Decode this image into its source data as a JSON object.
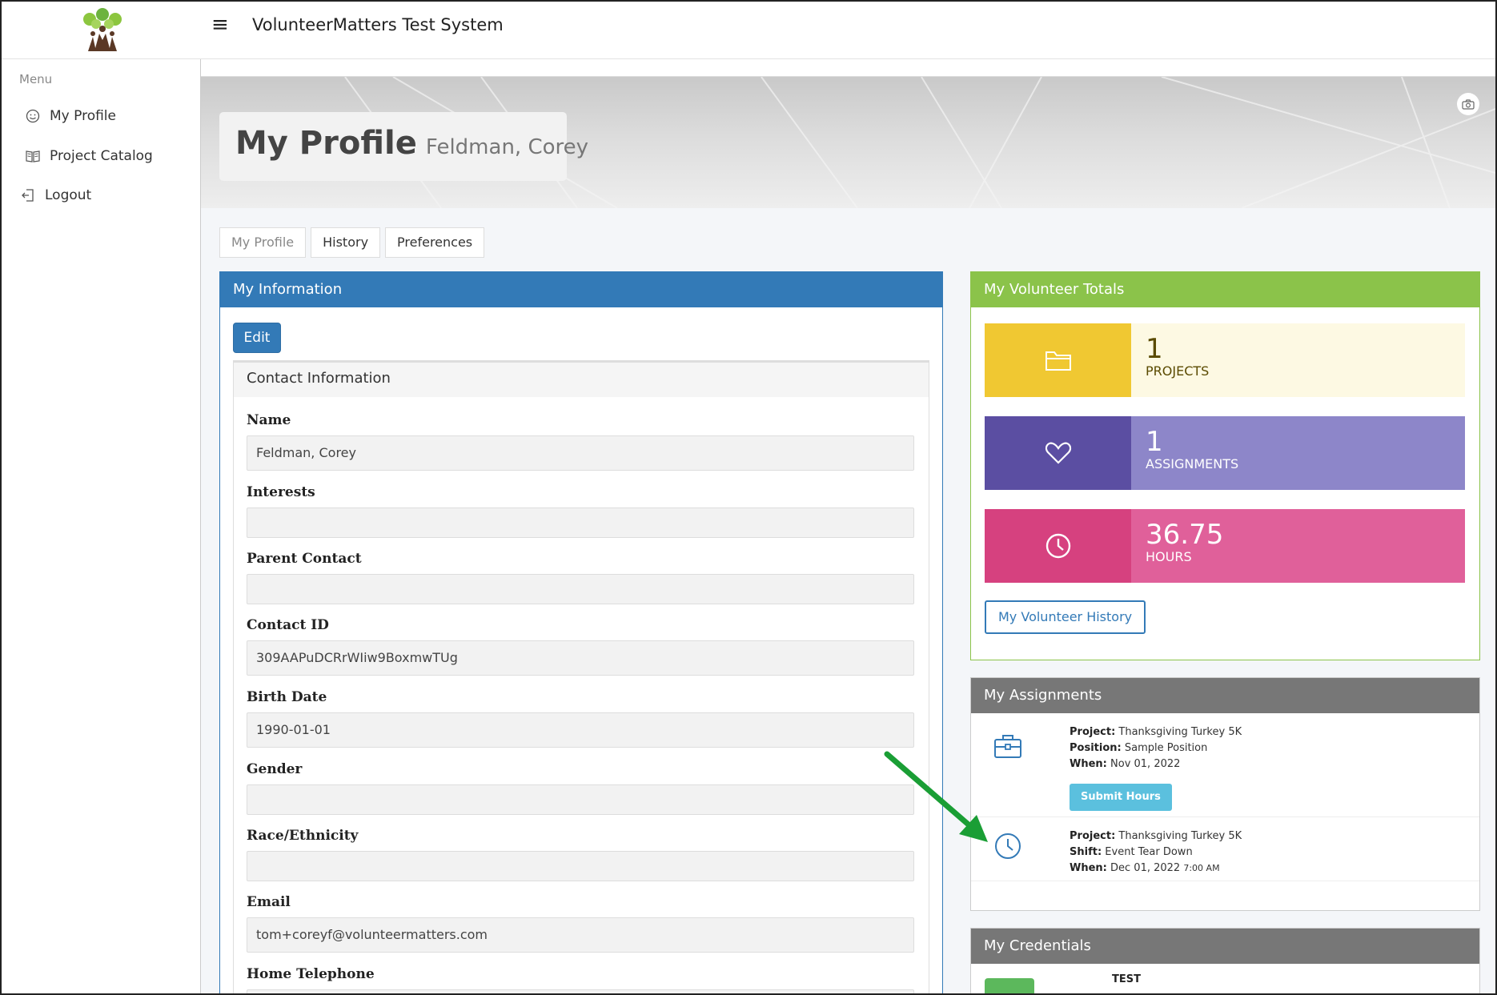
{
  "app": {
    "title": "VolunteerMatters Test System"
  },
  "sidebar": {
    "menu_label": "Menu",
    "items": [
      {
        "label": "My Profile",
        "icon": "smiley-icon"
      },
      {
        "label": "Project Catalog",
        "icon": "book-icon"
      },
      {
        "label": "Logout",
        "icon": "logout-icon"
      }
    ]
  },
  "hero": {
    "title": "My Profile",
    "subtitle": "Feldman, Corey"
  },
  "tabs": [
    {
      "label": "My Profile",
      "active": true
    },
    {
      "label": "History",
      "active": false
    },
    {
      "label": "Preferences",
      "active": false
    }
  ],
  "info": {
    "heading": "My Information",
    "edit_label": "Edit",
    "section_title": "Contact Information",
    "fields": [
      {
        "label": "Name",
        "value": "Feldman, Corey"
      },
      {
        "label": "Interests",
        "value": ""
      },
      {
        "label": "Parent Contact",
        "value": ""
      },
      {
        "label": "Contact ID",
        "value": "309AAPuDCRrWIiw9BoxmwTUg"
      },
      {
        "label": "Birth Date",
        "value": "1990-01-01"
      },
      {
        "label": "Gender",
        "value": ""
      },
      {
        "label": "Race/Ethnicity",
        "value": ""
      },
      {
        "label": "Email",
        "value": "tom+coreyf@volunteermatters.com"
      },
      {
        "label": "Home Telephone",
        "value": ""
      }
    ]
  },
  "totals": {
    "heading": "My Volunteer Totals",
    "stats": [
      {
        "value": "1",
        "label": "PROJECTS",
        "icon": "folder-icon",
        "icon_bg": "#f0c832",
        "body_bg": "#fdf9e3",
        "text_color": "#5a4a00"
      },
      {
        "value": "1",
        "label": "ASSIGNMENTS",
        "icon": "heart-icon",
        "icon_bg": "#5b4ea2",
        "body_bg": "#8d86c9",
        "text_color": "#ffffff"
      },
      {
        "value": "36.75",
        "label": "HOURS",
        "icon": "clock-icon",
        "icon_bg": "#d6417f",
        "body_bg": "#e0609a",
        "text_color": "#ffffff"
      }
    ],
    "history_button": "My Volunteer History"
  },
  "assignments": {
    "heading": "My Assignments",
    "items": [
      {
        "icon": "briefcase-icon",
        "project_key": "Project:",
        "project": "Thanksgiving Turkey 5K",
        "second_key": "Position:",
        "second": "Sample Position",
        "when_key": "When:",
        "when": "Nov 01, 2022",
        "time": "",
        "button": "Submit Hours"
      },
      {
        "icon": "clock-icon",
        "project_key": "Project:",
        "project": "Thanksgiving Turkey 5K",
        "second_key": "Shift:",
        "second": "Event Tear Down",
        "when_key": "When:",
        "when": "Dec 01, 2022",
        "time": "7:00 AM",
        "button": ""
      }
    ]
  },
  "credentials": {
    "heading": "My Credentials",
    "first_item": "TEST"
  },
  "colors": {
    "primary": "#337ab7",
    "success": "#8bc34a",
    "info": "#5bc0de",
    "annotation_arrow": "#1a9e35"
  }
}
